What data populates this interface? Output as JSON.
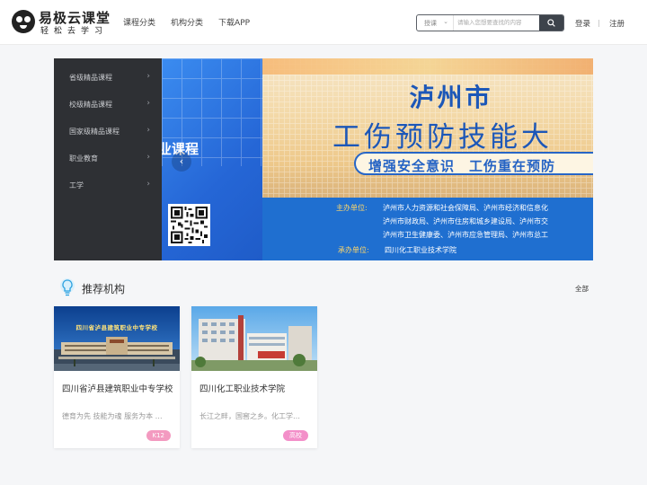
{
  "header": {
    "logo_title": "易极云课堂",
    "logo_sub": "轻松去学习",
    "nav": [
      "课程分类",
      "机构分类",
      "下载APP"
    ],
    "search": {
      "type": "授课",
      "placeholder": "请输入您想要查找的内容"
    },
    "login": "登录",
    "register": "注册"
  },
  "banner": {
    "categories": [
      "省级精品课程",
      "校级精品课程",
      "国家级精品课程",
      "职业教育",
      "工学"
    ],
    "left_title": "业课程",
    "poster": {
      "city": "泸州市",
      "title": "工伤预防技能大",
      "slogan": "增强安全意识　工伤重在预防",
      "host_label": "主办单位:",
      "host_lines": [
        "泸州市人力资源和社会保障局、泸州市经济和信息化",
        "泸州市财政局、泸州市住房和城乡建设局、泸州市交",
        "泸州市卫生健康委、泸州市应急管理局、泸州市总工"
      ],
      "organizer_label": "承办单位:",
      "organizer": "四川化工职业技术学院"
    }
  },
  "recommend": {
    "title": "推荐机构",
    "all": "全部",
    "cards": [
      {
        "name": "四川省泸县建筑职业中专学校",
        "desc": "德育为先 技能为魂 服务为本 …",
        "tag": "K12",
        "image_text": "四川省泸县建筑职业中专学校"
      },
      {
        "name": "四川化工职业技术学院",
        "desc": "长江之畔，国窖之乡。化工学…",
        "tag": "高校"
      }
    ]
  }
}
